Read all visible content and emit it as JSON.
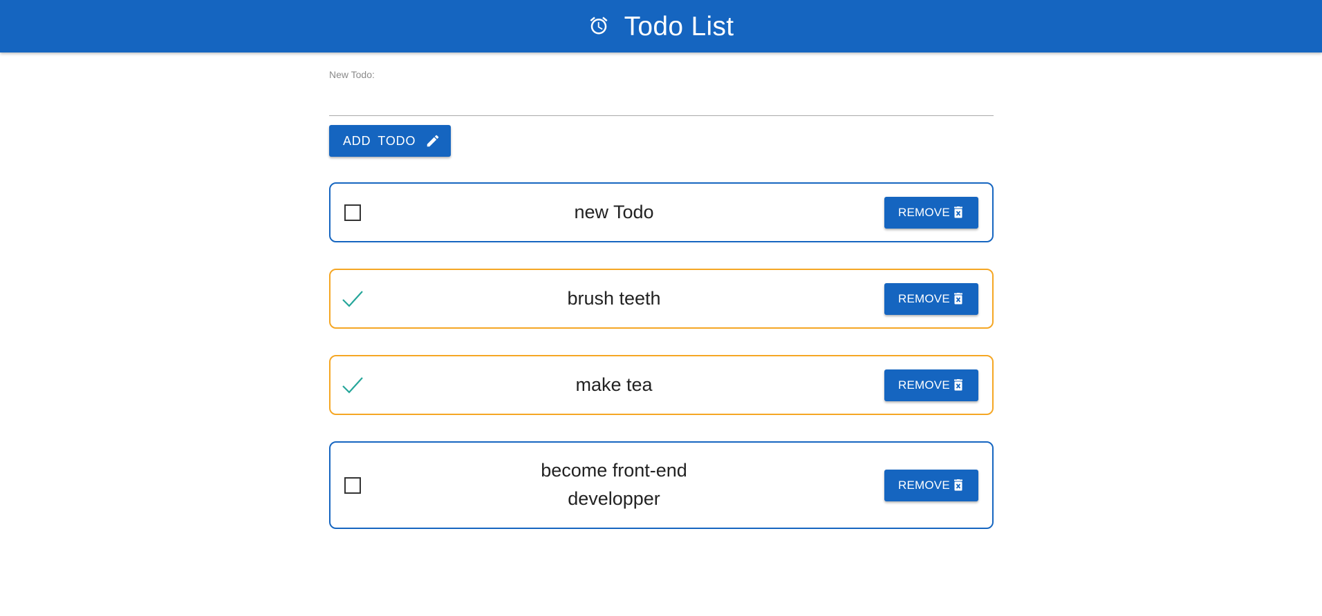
{
  "header": {
    "title": "Todo List",
    "icon": "alarm-clock-icon",
    "background": "#1565c0"
  },
  "form": {
    "label": "New Todo:",
    "value": "",
    "placeholder": "",
    "add_button": {
      "word1": "ADD",
      "word2": "TODO",
      "icon": "pencil-icon"
    }
  },
  "todos": [
    {
      "text": "new Todo",
      "completed": false,
      "remove_label": "REMOVE"
    },
    {
      "text": "brush teeth",
      "completed": true,
      "remove_label": "REMOVE"
    },
    {
      "text": "make tea",
      "completed": true,
      "remove_label": "REMOVE"
    },
    {
      "text": "become front-end developper",
      "completed": false,
      "remove_label": "REMOVE"
    }
  ],
  "colors": {
    "primary": "#1565c0",
    "completed_border": "#f5a623",
    "check": "#26a69a"
  }
}
